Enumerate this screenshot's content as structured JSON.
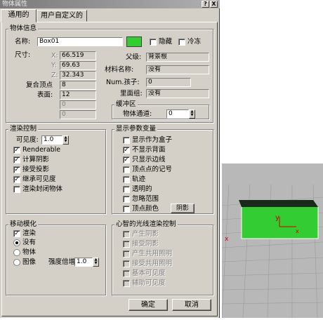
{
  "window": {
    "title": "物体属性",
    "help_btn": "?",
    "close_btn": "X"
  },
  "tabs": [
    {
      "label": "通用的"
    },
    {
      "label": "用户自定义的"
    }
  ],
  "object_info": {
    "group_title": "物体信息",
    "name_label": "名称:",
    "name_value": "Box01",
    "color": "#33cc33",
    "hide_label": "隐藏",
    "freeze_label": "冷冻",
    "dimensions_label": "尺寸:",
    "x_label": "X:",
    "x_value": "66.519",
    "y_label": "Y:",
    "y_value": "69.63",
    "z_label": "Z:",
    "z_value": "32.343",
    "verts_label": "复合顶点",
    "verts_value": "8",
    "faces_label": "表面:",
    "faces_value": "12",
    "extra1_value": "0",
    "extra2_value": "0",
    "parent_label": "父级:",
    "parent_value": "背景根",
    "material_label": "材料名称:",
    "material_value": "没有",
    "children_label": "Num.孩子:",
    "children_value": "0",
    "group_label": "里面组:",
    "group_value": "没有"
  },
  "gbuffer": {
    "group_title": "缓冲区",
    "channel_label": "物体通道:",
    "channel_value": "0"
  },
  "render_control": {
    "group_title": "渲染控制",
    "visibility_label": "可见度:",
    "visibility_value": "1.0",
    "options": [
      {
        "label": "Renderable",
        "checked": true
      },
      {
        "label": "计算阴影",
        "checked": true
      },
      {
        "label": "接受投影",
        "checked": true
      },
      {
        "label": "继承可见度",
        "checked": true
      },
      {
        "label": "渲染封闭物体",
        "checked": false
      }
    ]
  },
  "display_props": {
    "group_title": "显示参数变量",
    "options": [
      {
        "label": "显示作为盒子",
        "checked": false
      },
      {
        "label": "不显示背面",
        "checked": true
      },
      {
        "label": "只显示边线",
        "checked": true
      },
      {
        "label": "顶点点的记号",
        "checked": false
      },
      {
        "label": "轨迹",
        "checked": false
      },
      {
        "label": "透明的",
        "checked": false
      },
      {
        "label": "忽略范围",
        "checked": false
      },
      {
        "label": "顶点颜色",
        "checked": false
      }
    ],
    "shaded_button": "阴影"
  },
  "motion_blur": {
    "group_title": "移动模化",
    "enabled_label": "渲染",
    "enabled_checked": true,
    "radios": [
      {
        "label": "没有",
        "selected": true
      },
      {
        "label": "物体",
        "selected": false
      },
      {
        "label": "图像",
        "selected": false
      }
    ],
    "multiplier_label": "强度倍增",
    "multiplier_value": "1.0"
  },
  "radiosity": {
    "group_title": "心智的光线渲染控制",
    "options": [
      {
        "label": "产生阴影"
      },
      {
        "label": "接受阴影"
      },
      {
        "label": "产生共用照明"
      },
      {
        "label": "接受共用照明"
      },
      {
        "label": "基本可见度"
      },
      {
        "label": "辅助可见度"
      }
    ]
  },
  "buttons": {
    "ok": "确定",
    "cancel": "取消"
  },
  "viewport": {
    "background": "#b8b8b8",
    "box_color": "#33cc33",
    "axis_y_label": "y",
    "axis_x_label": "x"
  }
}
